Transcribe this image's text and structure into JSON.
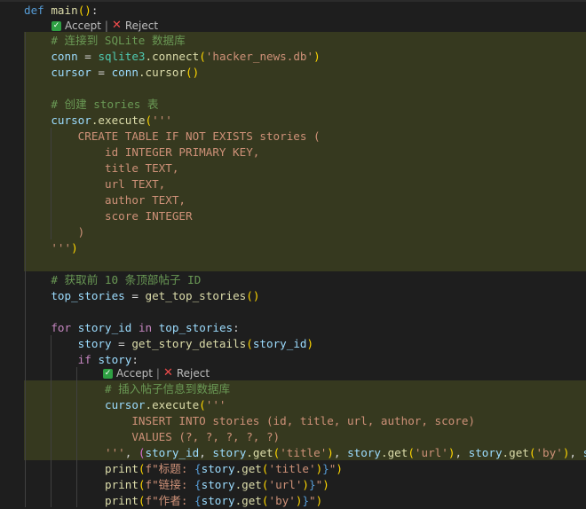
{
  "window": {
    "kind": "code-editor",
    "language": "python"
  },
  "colors": {
    "highlight": "#36391f",
    "accept_check": "#2ea043",
    "reject_x": "#f14c4c"
  },
  "gutter": {
    "numbers": [
      "",
      "",
      "",
      "",
      "",
      "",
      "",
      "",
      "",
      "",
      "",
      "",
      "",
      "",
      "",
      "",
      "",
      "",
      "",
      "",
      "",
      "",
      "",
      "",
      "",
      "",
      "",
      "",
      "",
      "",
      "",
      ""
    ]
  },
  "accept_reject_1": {
    "accept_label": "Accept",
    "separator": "|",
    "reject_label": "Reject"
  },
  "accept_reject_2": {
    "accept_label": "Accept",
    "separator": "|",
    "reject_label": "Reject"
  },
  "code": {
    "l1_kw": "def",
    "l1_name": "main",
    "l1_rest": "():",
    "l2_comment": "# 连接到 SQLite 数据库",
    "l3_var": "conn",
    "l3_eq": " = ",
    "l3_mod": "sqlite3",
    "l3_fn": ".connect",
    "l3_str": "'hacker_news.db'",
    "l4_var": "cursor",
    "l4_eq": " = ",
    "l4_obj": "conn",
    "l4_fn": ".cursor",
    "l6_comment": "# 创建 stories 表",
    "l7_var": "cursor",
    "l7_fn": ".execute",
    "l7_str": "'''",
    "l8": "    CREATE TABLE IF NOT EXISTS stories (",
    "l9": "        id INTEGER PRIMARY KEY,",
    "l10": "        title TEXT,",
    "l11": "        url TEXT,",
    "l12": "        author TEXT,",
    "l13": "        score INTEGER",
    "l14": "    )",
    "l15_str": "'''",
    "l17_comment": "# 获取前 10 条顶部帖子 ID",
    "l18_var": "top_stories",
    "l18_eq": " = ",
    "l18_fn": "get_top_stories",
    "l20_kw": "for",
    "l20_var": "story_id",
    "l20_in": "in",
    "l20_src": "top_stories",
    "l21_var": "story",
    "l21_eq": " = ",
    "l21_fn": "get_story_details",
    "l21_arg": "story_id",
    "l22_kw": "if",
    "l22_var": "story",
    "l23_comment": "# 插入帖子信息到数据库",
    "l24_var": "cursor",
    "l24_fn": ".execute",
    "l24_str": "'''",
    "l25": "    INSERT INTO stories (id, title, url, author, score)",
    "l26": "    VALUES (?, ?, ?, ?, ?)",
    "l27_str": "'''",
    "l27_rest_a": ", ",
    "l27_var1": "story_id",
    "l27_sep": ", ",
    "l27_v2": "story",
    "l27_g1": ".get",
    "l27_s1": "'title'",
    "l27_v3": "story",
    "l27_g2": ".get",
    "l27_s2": "'url'",
    "l27_v4": "story",
    "l27_g3": ".get",
    "l27_s3": "'by'",
    "l27_tail": "stor",
    "l28_fn": "print",
    "l28_str_a": "f\"标题: ",
    "l28_var": "story",
    "l28_get": ".get",
    "l28_key": "'title'",
    "l28_str_b": "\"",
    "l29_fn": "print",
    "l29_str_a": "f\"链接: ",
    "l29_var": "story",
    "l29_get": ".get",
    "l29_key": "'url'",
    "l29_str_b": "\"",
    "l30_fn": "print",
    "l30_str_a": "f\"作者: ",
    "l30_var": "story",
    "l30_get": ".get",
    "l30_key": "'by'",
    "l30_str_b": "\""
  }
}
